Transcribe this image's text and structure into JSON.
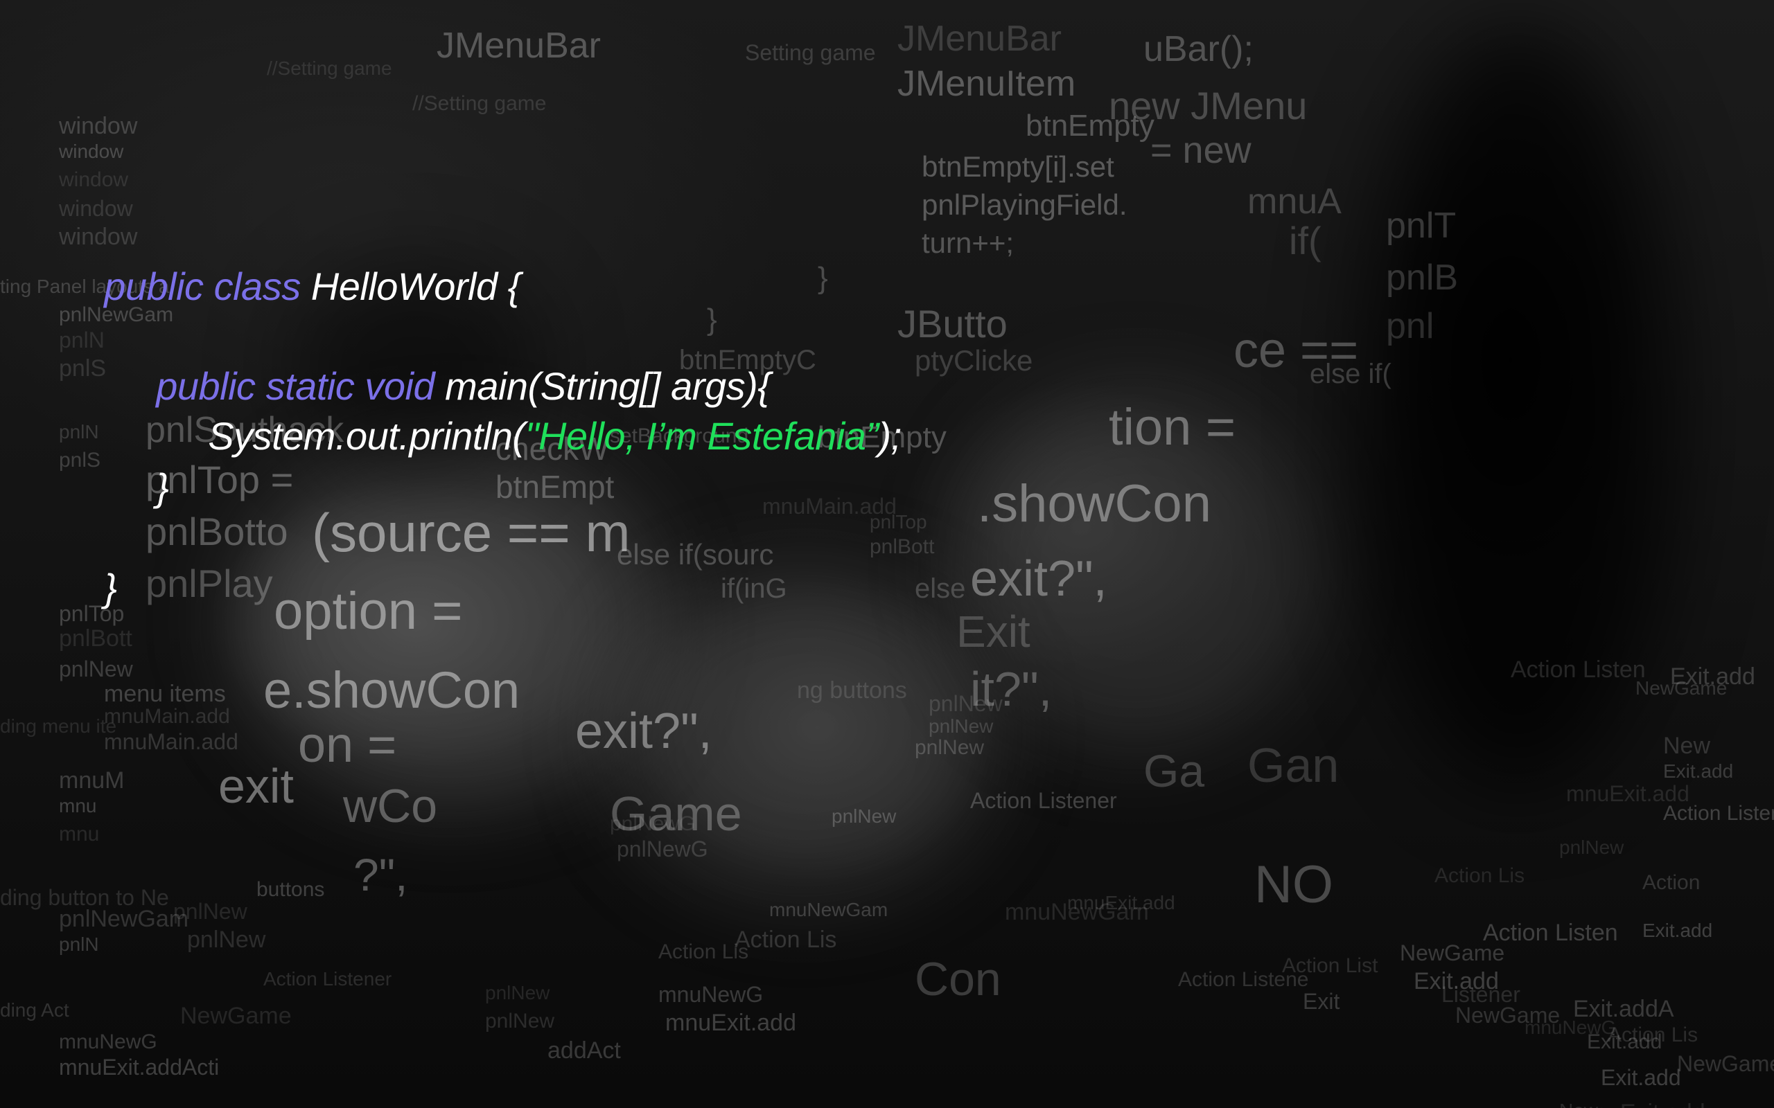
{
  "colors": {
    "keyword": "#7b70e8",
    "plain": "#ffffff",
    "string": "#1fe05b",
    "background": "#111111"
  },
  "code": {
    "line1": {
      "kw": "public class",
      "plain": " HelloWorld {"
    },
    "line2": {
      "kw": "public static void",
      "plain": " main(String[] args){"
    },
    "line3": {
      "pre": "System.out.println(",
      "str": "\"Hello, I’m Estefania”",
      "post": ");"
    },
    "line4": "}",
    "line5": "}"
  },
  "background_text": {
    "large": [
      "(source == m",
      "option =",
      "e.showCon",
      "exit?\",",
      "exit",
      "on =",
      "wCo",
      "Game",
      "?\",",
      "pnlTop =",
      "pnlBotto",
      "pnlPlay",
      "pnlSouthack",
      "tion =",
      ".showCon",
      "exit?\",",
      "it?\",",
      "ce ==",
      "NO",
      "Con",
      "Ga",
      "JMenuBar",
      "JMenuItem",
      "new JMenu",
      "uBar();",
      "JMenuBar",
      "JButto",
      "pnlT",
      "pnlB",
      "pnl",
      "Gan",
      "Exit"
    ],
    "medium": [
      "btnEmpty",
      "btnEmpty[i].set",
      "pnlPlayingField.",
      "turn++;",
      "= new",
      "mnuA",
      "if(",
      "}",
      "}",
      "checkW",
      "btnEmpt",
      "else if(sourc",
      "if(inG",
      "btnEmpty",
      "else if(",
      "else",
      "ptyClicke",
      "btnEmptyC"
    ],
    "small": [
      "//Setting game",
      "//Setting game",
      "Setting game",
      "window",
      "window",
      "window",
      "window",
      "window",
      "ting Panel layouts a",
      "pnlNewGam",
      "pnlN",
      "pnlS",
      "pnlN",
      "pnlS",
      "pnlTop",
      "pnlBott",
      "pnlTop",
      "pnlBott",
      "pnlNew",
      "menu items",
      "ding menu ite",
      "mnuMain.add",
      "mnuMain.add",
      "mnuM",
      "mnu",
      "mnu",
      "ding button to Ne",
      "pnlNewGam",
      "pnlN",
      "buttons",
      "pnlNew",
      "pnlNew",
      "ding Act",
      "mnuNewG",
      "mnuExit.addActi",
      "NewGame",
      "Action Listener",
      "Action Lis",
      "mnuNewG",
      "mnuExit.add",
      "pnlNew",
      "pnlNew",
      "pnlNewG",
      "addAct",
      "pnlNew",
      "pnlNewG",
      "pnlNew",
      "Action Lis",
      "mnuNewGam",
      "setBackground",
      "mnuMain.add",
      "ng buttons",
      "pnlNew",
      "pnlNew",
      "Action Listener",
      "mnuNewGam",
      "mnuExit.add",
      "Action Listene",
      "NewGame",
      "Exit.add",
      "pnlNew",
      "Action List",
      "NewGame",
      "Exit.addA",
      "Exit.add",
      "Action Lis",
      "Listener",
      "New",
      "Exit.add",
      "Action Listen",
      "mnuExit.add",
      "Action Listen",
      "NewGame",
      "Exit.add",
      "Exit.add",
      "nuExit.add",
      "New",
      "Action",
      "Exit",
      "Action Listen",
      "mnuNewG",
      "Action Lis",
      "NewGame",
      "Exit.add"
    ]
  }
}
